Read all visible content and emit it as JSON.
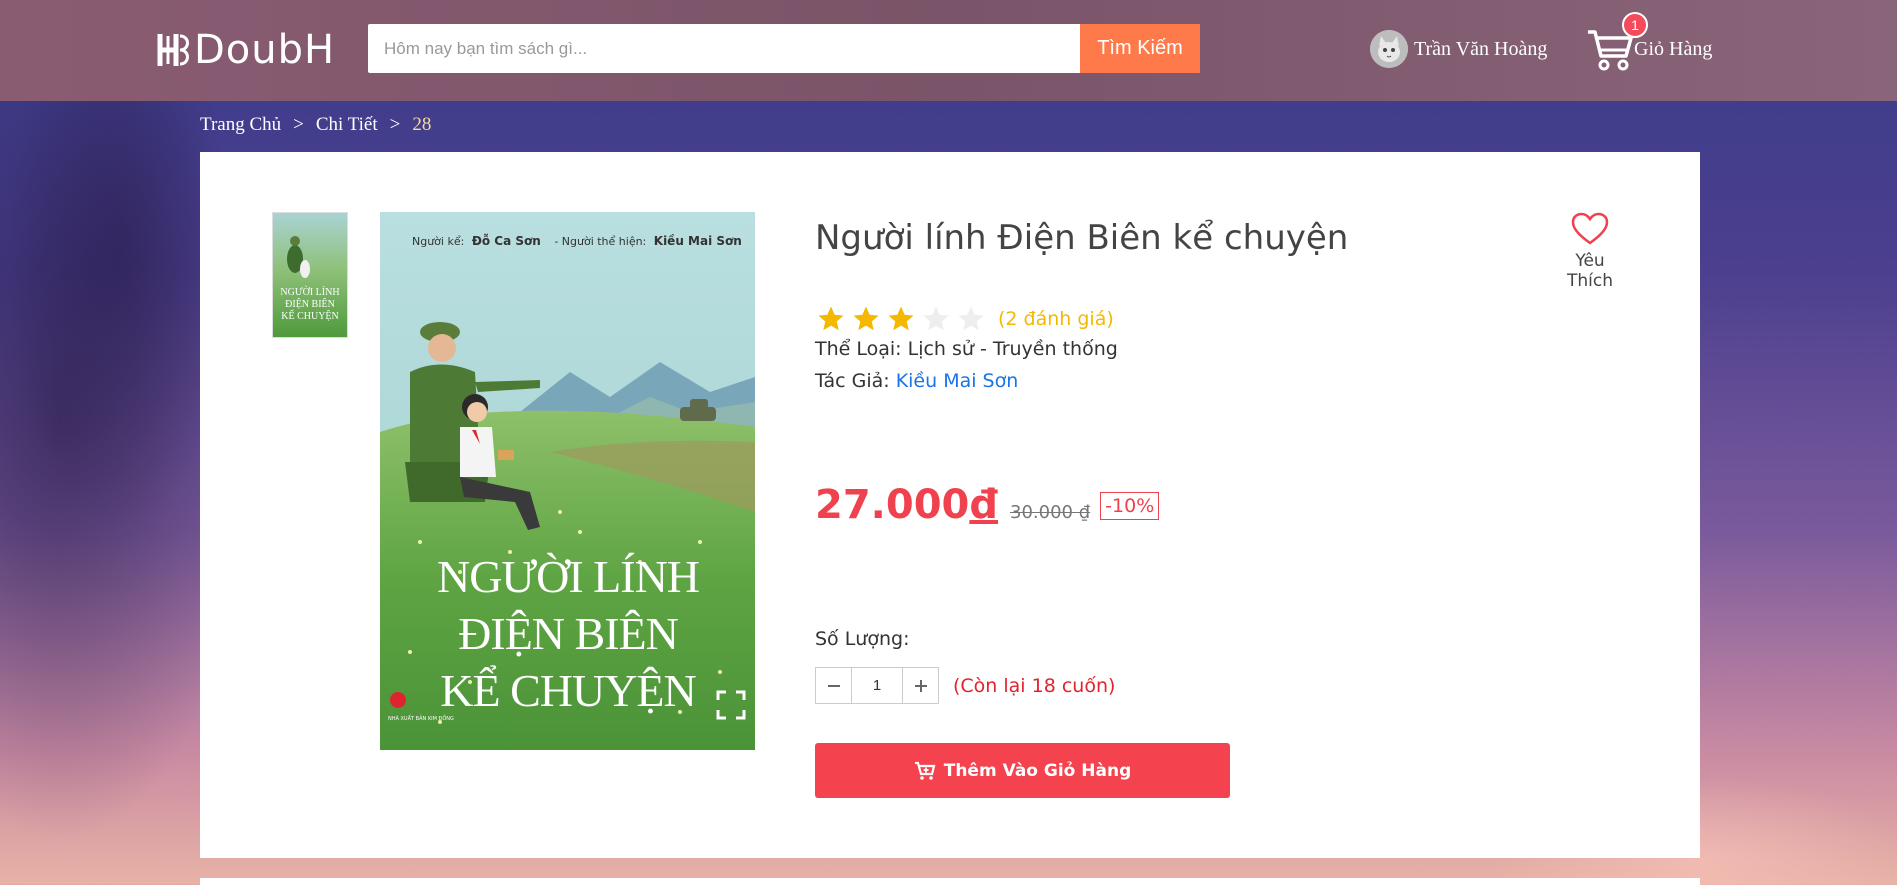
{
  "header": {
    "logo_text": "DoubH",
    "search_placeholder": "Hôm nay bạn tìm sách gì...",
    "search_button": "Tìm Kiếm",
    "user_name": "Trần Văn Hoàng",
    "cart_label": "Giỏ Hàng",
    "cart_count": "1"
  },
  "breadcrumb": {
    "items": [
      "Trang Chủ",
      "Chi Tiết",
      "28"
    ],
    "separator": ">"
  },
  "product": {
    "title": "Người lính Điện Biên kể chuyện",
    "favorite_label": "Yêu Thích",
    "rating": 3,
    "rating_max": 5,
    "reviews_text": "(2 đánh giá)",
    "category_label": "Thể Loại:",
    "category_value": "Lịch sử - Truyền thống",
    "author_label": "Tác Giả:",
    "author_value": "Kiều Mai Sơn",
    "price_amount": "27.000",
    "price_currency": "đ",
    "old_price": "30.000 ₫",
    "discount": "-10%",
    "quantity_label": "Số Lượng:",
    "quantity_value": "1",
    "stock_text": "(Còn lại 18 cuốn)",
    "add_to_cart": "Thêm Vào Giỏ Hàng"
  },
  "cover": {
    "narrator_label": "Người kể:",
    "narrator": "Đỗ Ca Sơn",
    "illustrator_label": "- Người thể hiện:",
    "illustrator": "Kiều Mai Sơn",
    "title_lines": [
      "NGƯỜI LÍNH",
      "ĐIỆN BIÊN",
      "KỂ CHUYỆN"
    ],
    "publisher": "NHÀ XUẤT BẢN KIM ĐỒNG"
  },
  "colors": {
    "accent": "#f5424f",
    "search_button": "#ff7a4a",
    "star": "#f5b800",
    "link": "#1a73e8"
  }
}
